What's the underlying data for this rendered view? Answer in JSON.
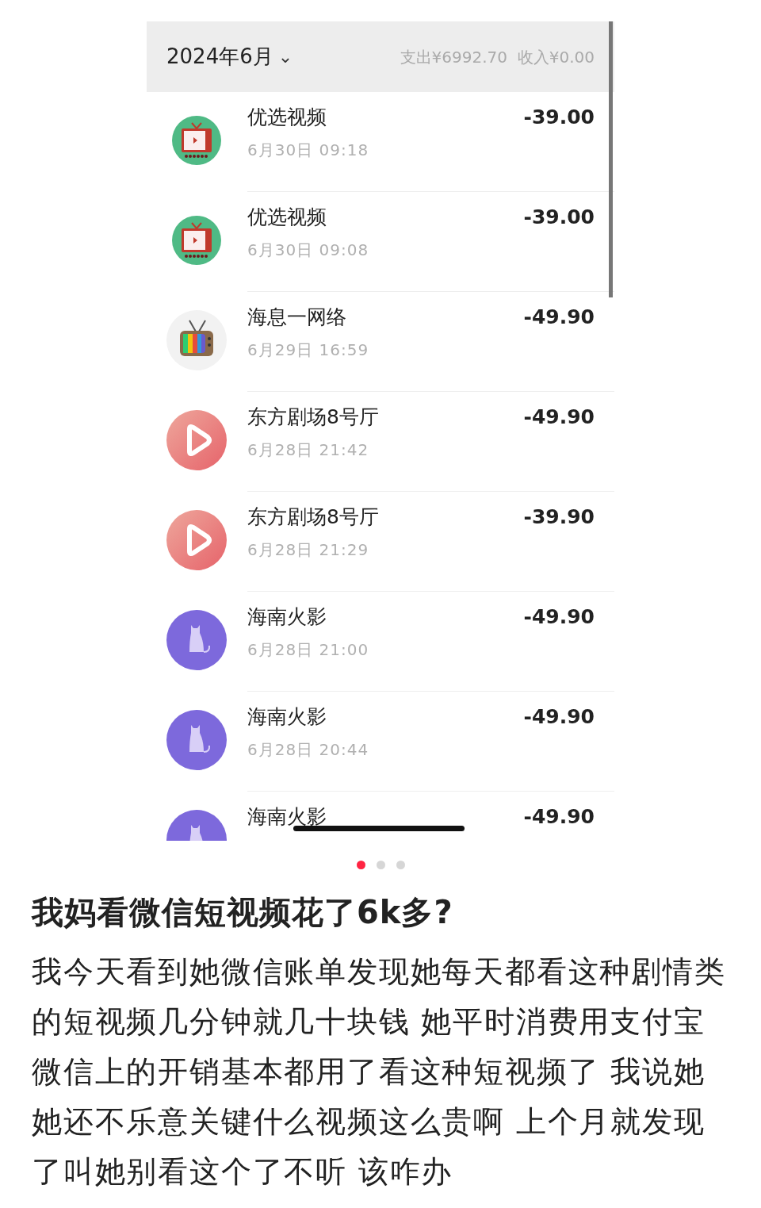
{
  "bill": {
    "month": "2024年6月",
    "caret": "⌄",
    "summary": "支出¥6992.70  收入¥0.00",
    "transactions": [
      {
        "kind": "tv-green",
        "name": "优选视频",
        "time": "6月30日 09:18",
        "amount": "-39.00"
      },
      {
        "kind": "tv-green",
        "name": "优选视频",
        "time": "6月30日 09:08",
        "amount": "-39.00"
      },
      {
        "kind": "tv-retro",
        "name": "海息一网络",
        "time": "6月29日 16:59",
        "amount": "-49.90"
      },
      {
        "kind": "play-red",
        "name": "东方剧场8号厅",
        "time": "6月28日 21:42",
        "amount": "-49.90"
      },
      {
        "kind": "play-red",
        "name": "东方剧场8号厅",
        "time": "6月28日 21:29",
        "amount": "-39.90"
      },
      {
        "kind": "cat-purple",
        "name": "海南火影",
        "time": "6月28日 21:00",
        "amount": "-49.90"
      },
      {
        "kind": "cat-purple",
        "name": "海南火影",
        "time": "6月28日 20:44",
        "amount": "-49.90"
      },
      {
        "kind": "cat-purple",
        "name": "海南火影",
        "amount": "-49.90"
      }
    ]
  },
  "pager": [
    {
      "selected": true
    },
    {
      "selected": false
    },
    {
      "selected": false
    }
  ],
  "post": {
    "title": "我妈看微信短视频花了6k多?",
    "body": "我今天看到她微信账单发现她每天都看这种剧情类的短视频几分钟就几十块钱 她平时消费用支付宝微信上的开销基本都用了看这种短视频了 我说她她还不乐意关键什么视频这么贵啊 上个月就发现了叫她别看这个了不听 该咋办"
  }
}
